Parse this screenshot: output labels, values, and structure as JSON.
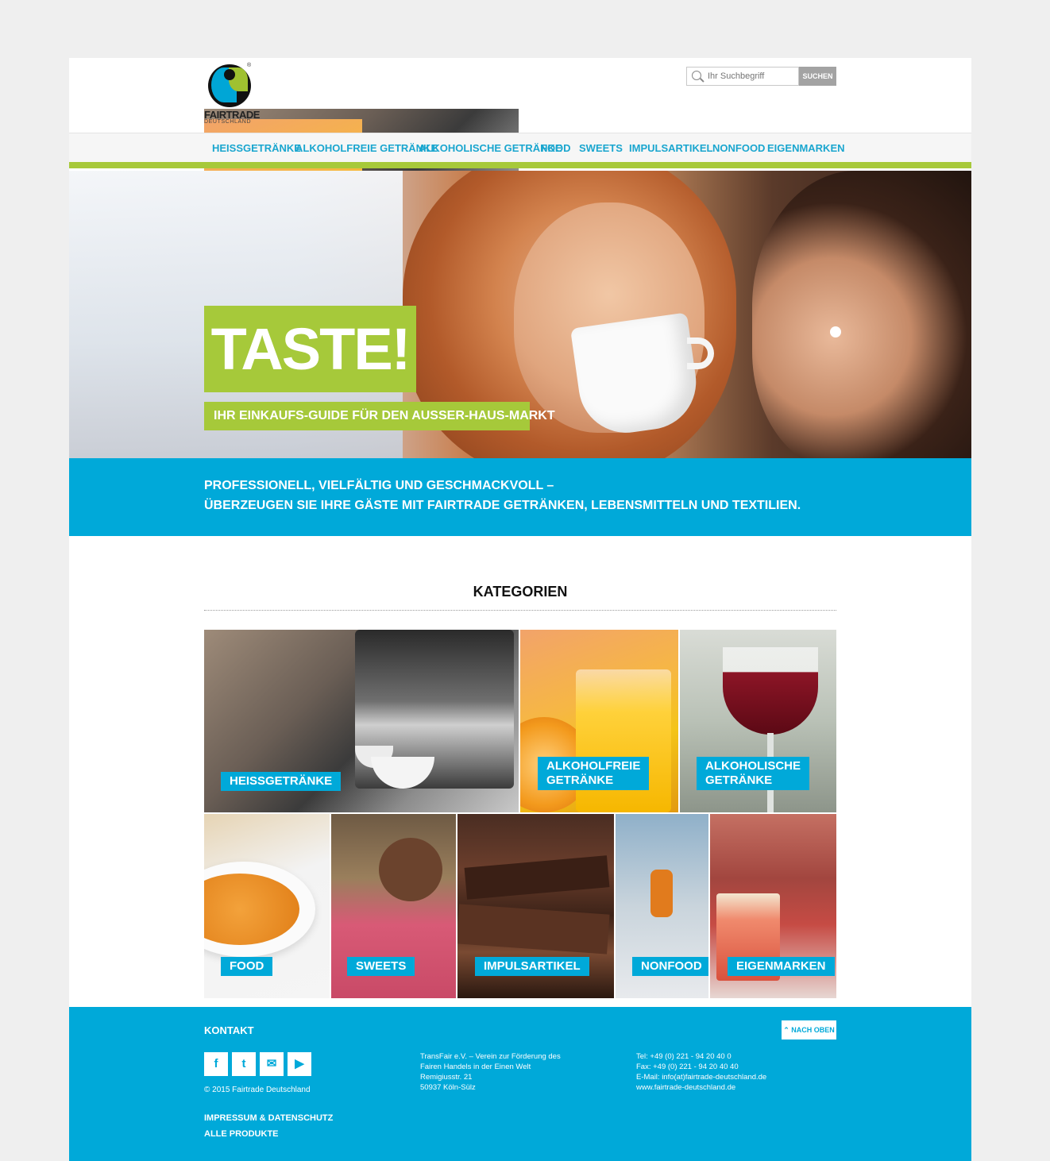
{
  "header": {
    "logo_text": "FAIRTRADE",
    "logo_subtext": "DEUTSCHLAND",
    "search_placeholder": "Ihr Suchbegriff",
    "search_button": "SUCHEN"
  },
  "nav": {
    "items": [
      "HEISSGETRÄNKE",
      "ALKOHOLFREIE GETRÄNKE",
      "ALKOHOLISCHE GETRÄNKE",
      "FOOD",
      "SWEETS",
      "IMPULSARTIKEL",
      "NONFOOD",
      "EIGENMARKEN"
    ]
  },
  "hero": {
    "title": "TASTE!",
    "subtitle": "IHR EINKAUFS-GUIDE FÜR DEN AUSSER-HAUS-MARKT"
  },
  "band": {
    "line1": "PROFESSIONELL, VIELFÄLTIG UND GESCHMACKVOLL –",
    "line2": "ÜBERZEUGEN SIE IHRE GÄSTE MIT FAIRTRADE GETRÄNKEN, LEBENSMITTELN UND TEXTILIEN."
  },
  "categories": {
    "title": "KATEGORIEN",
    "tiles": [
      {
        "label": "HEISSGETRÄNKE"
      },
      {
        "label_line1": "ALKOHOLFREIE",
        "label_line2": "GETRÄNKE"
      },
      {
        "label_line1": "ALKOHOLISCHE",
        "label_line2": "GETRÄNKE"
      },
      {
        "label": "FOOD"
      },
      {
        "label": "SWEETS"
      },
      {
        "label": "IMPULSARTIKEL"
      },
      {
        "label": "NONFOOD"
      },
      {
        "label": "EIGENMARKEN"
      }
    ]
  },
  "footer": {
    "kontakt": "KONTAKT",
    "back_to_top": "NACH OBEN",
    "social": [
      {
        "icon": "facebook-icon",
        "glyph": "f"
      },
      {
        "icon": "twitter-icon",
        "glyph": "t"
      },
      {
        "icon": "mail-icon",
        "glyph": "✉"
      },
      {
        "icon": "youtube-icon",
        "glyph": "▶"
      }
    ],
    "copyright": "© 2015 Fairtrade Deutschland",
    "links": [
      "IMPRESSUM & DATENSCHUTZ",
      "ALLE PRODUKTE"
    ],
    "address": [
      "TransFair e.V. – Verein zur Förderung des",
      "Fairen Handels in der Einen Welt",
      "Remigiusstr. 21",
      "50937 Köln-Sülz"
    ],
    "contact": [
      "Tel: +49 (0) 221 - 94 20 40 0",
      "Fax: +49 (0) 221 - 94 20 40 40",
      "E-Mail: info(at)fairtrade-deutschland.de",
      "www.fairtrade-deutschland.de"
    ]
  },
  "colors": {
    "accent_blue": "#00a9d9",
    "accent_green": "#a6c93a",
    "background": "#efefef"
  }
}
